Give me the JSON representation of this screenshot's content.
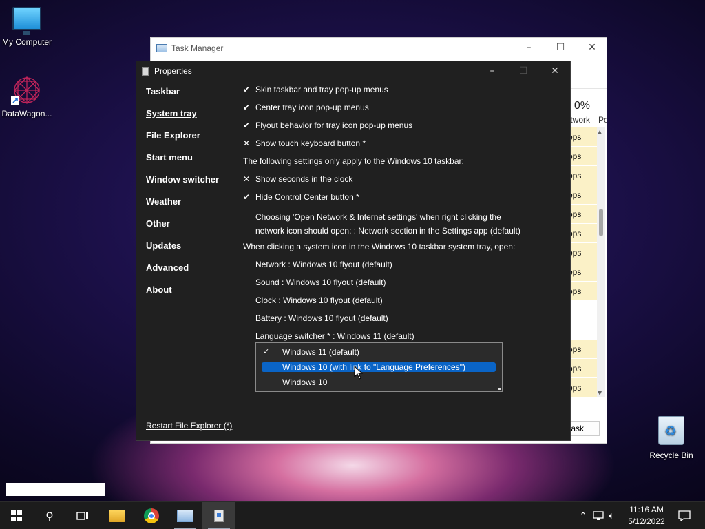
{
  "desktop": {
    "icons": [
      {
        "label": "My Computer",
        "icon": "computer-icon"
      },
      {
        "label": "DataWagon...",
        "icon": "datawagon-icon"
      },
      {
        "label": "Recycle Bin",
        "icon": "recycle-bin-icon"
      }
    ]
  },
  "task_manager": {
    "title": "Task Manager",
    "network_percent": "0%",
    "column_network": "twork",
    "column_po": "Po",
    "row_value": "Mbps",
    "rows": [
      "Mbps",
      "Mbps",
      "Mbps",
      "Mbps",
      "Mbps",
      "Mbps",
      "Mbps",
      "Mbps",
      "Mbps",
      "",
      "Mbps",
      "Mbps",
      "Mbps"
    ],
    "end_task_label": "task"
  },
  "properties": {
    "title": "Properties",
    "nav": [
      {
        "label": "Taskbar",
        "active": false
      },
      {
        "label": "System tray",
        "active": true
      },
      {
        "label": "File Explorer",
        "active": false
      },
      {
        "label": "Start menu",
        "active": false
      },
      {
        "label": "Window switcher",
        "active": false
      },
      {
        "label": "Weather",
        "active": false
      },
      {
        "label": "Other",
        "active": false
      },
      {
        "label": "Updates",
        "active": false
      },
      {
        "label": "Advanced",
        "active": false
      },
      {
        "label": "About",
        "active": false
      }
    ],
    "restart_link": "Restart File Explorer (*)",
    "options": [
      {
        "mark": "✔",
        "text": "Skin taskbar and tray pop-up menus"
      },
      {
        "mark": "✔",
        "text": "Center tray icon pop-up menus"
      },
      {
        "mark": "✔",
        "text": "Flyout behavior for tray icon pop-up menus"
      },
      {
        "mark": "✕",
        "text": "Show touch keyboard button *"
      }
    ],
    "win10_note": "The following settings only apply to the Windows 10 taskbar:",
    "win10_options": [
      {
        "mark": "✕",
        "text": "Show seconds in the clock"
      },
      {
        "mark": "✔",
        "text": "Hide Control Center button *"
      }
    ],
    "network_choice_line1": "Choosing 'Open Network & Internet settings' when right clicking the",
    "network_choice_line2": "network icon should open: : Network section in the Settings app (default)",
    "system_icon_note": "When clicking a system icon in the Windows 10 taskbar system tray, open:",
    "icon_settings": [
      "Network : Windows 10 flyout (default)",
      "Sound : Windows 10 flyout (default)",
      "Clock : Windows 10 flyout (default)",
      "Battery : Windows 10 flyout (default)",
      "Language switcher * : Windows 11 (default)"
    ],
    "dropdown": [
      {
        "label": "Windows 11 (default)",
        "checked": true,
        "selected": false
      },
      {
        "label": "Windows 10 (with link to \"Language Preferences\")",
        "checked": false,
        "selected": true
      },
      {
        "label": "Windows 10",
        "checked": false,
        "selected": false
      }
    ]
  },
  "taskbar": {
    "time": "11:16 AM",
    "date": "5/12/2022",
    "apps": [
      "start-icon",
      "search-icon",
      "task-view-icon",
      "file-explorer-icon",
      "chrome-icon",
      "task-manager-icon",
      "properties-icon"
    ]
  }
}
